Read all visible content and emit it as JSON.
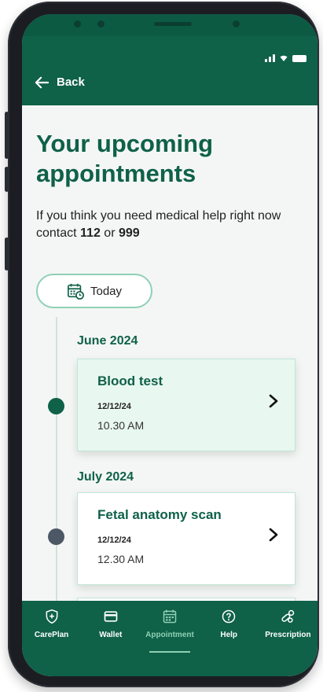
{
  "header": {
    "back_label": "Back"
  },
  "main": {
    "title": "Your upcoming appointments",
    "subtext_prefix": "If you think you need medical help right now contact ",
    "phone_1": "112",
    "subtext_or": " or ",
    "phone_2": "999",
    "today_label": "Today"
  },
  "timeline": [
    {
      "month": "June 2024",
      "title": "Blood test",
      "date": "12/12/24",
      "time": "10.30 AM"
    },
    {
      "month": "July 2024",
      "title": "Fetal anatomy scan",
      "date": "12/12/24",
      "time": "12.30 AM"
    }
  ],
  "nav": {
    "items": [
      {
        "label": "CarePlan",
        "icon": "shield-plus-icon"
      },
      {
        "label": "Wallet",
        "icon": "card-icon"
      },
      {
        "label": "Appointment",
        "icon": "calendar-icon",
        "active": true
      },
      {
        "label": "Help",
        "icon": "help-icon"
      },
      {
        "label": "Prescription",
        "icon": "pills-icon"
      }
    ]
  },
  "colors": {
    "brand_green": "#0f6148",
    "accent_mint": "#8fd0b6",
    "active_dot": "#0f6148",
    "inactive_dot": "#4d5866"
  }
}
